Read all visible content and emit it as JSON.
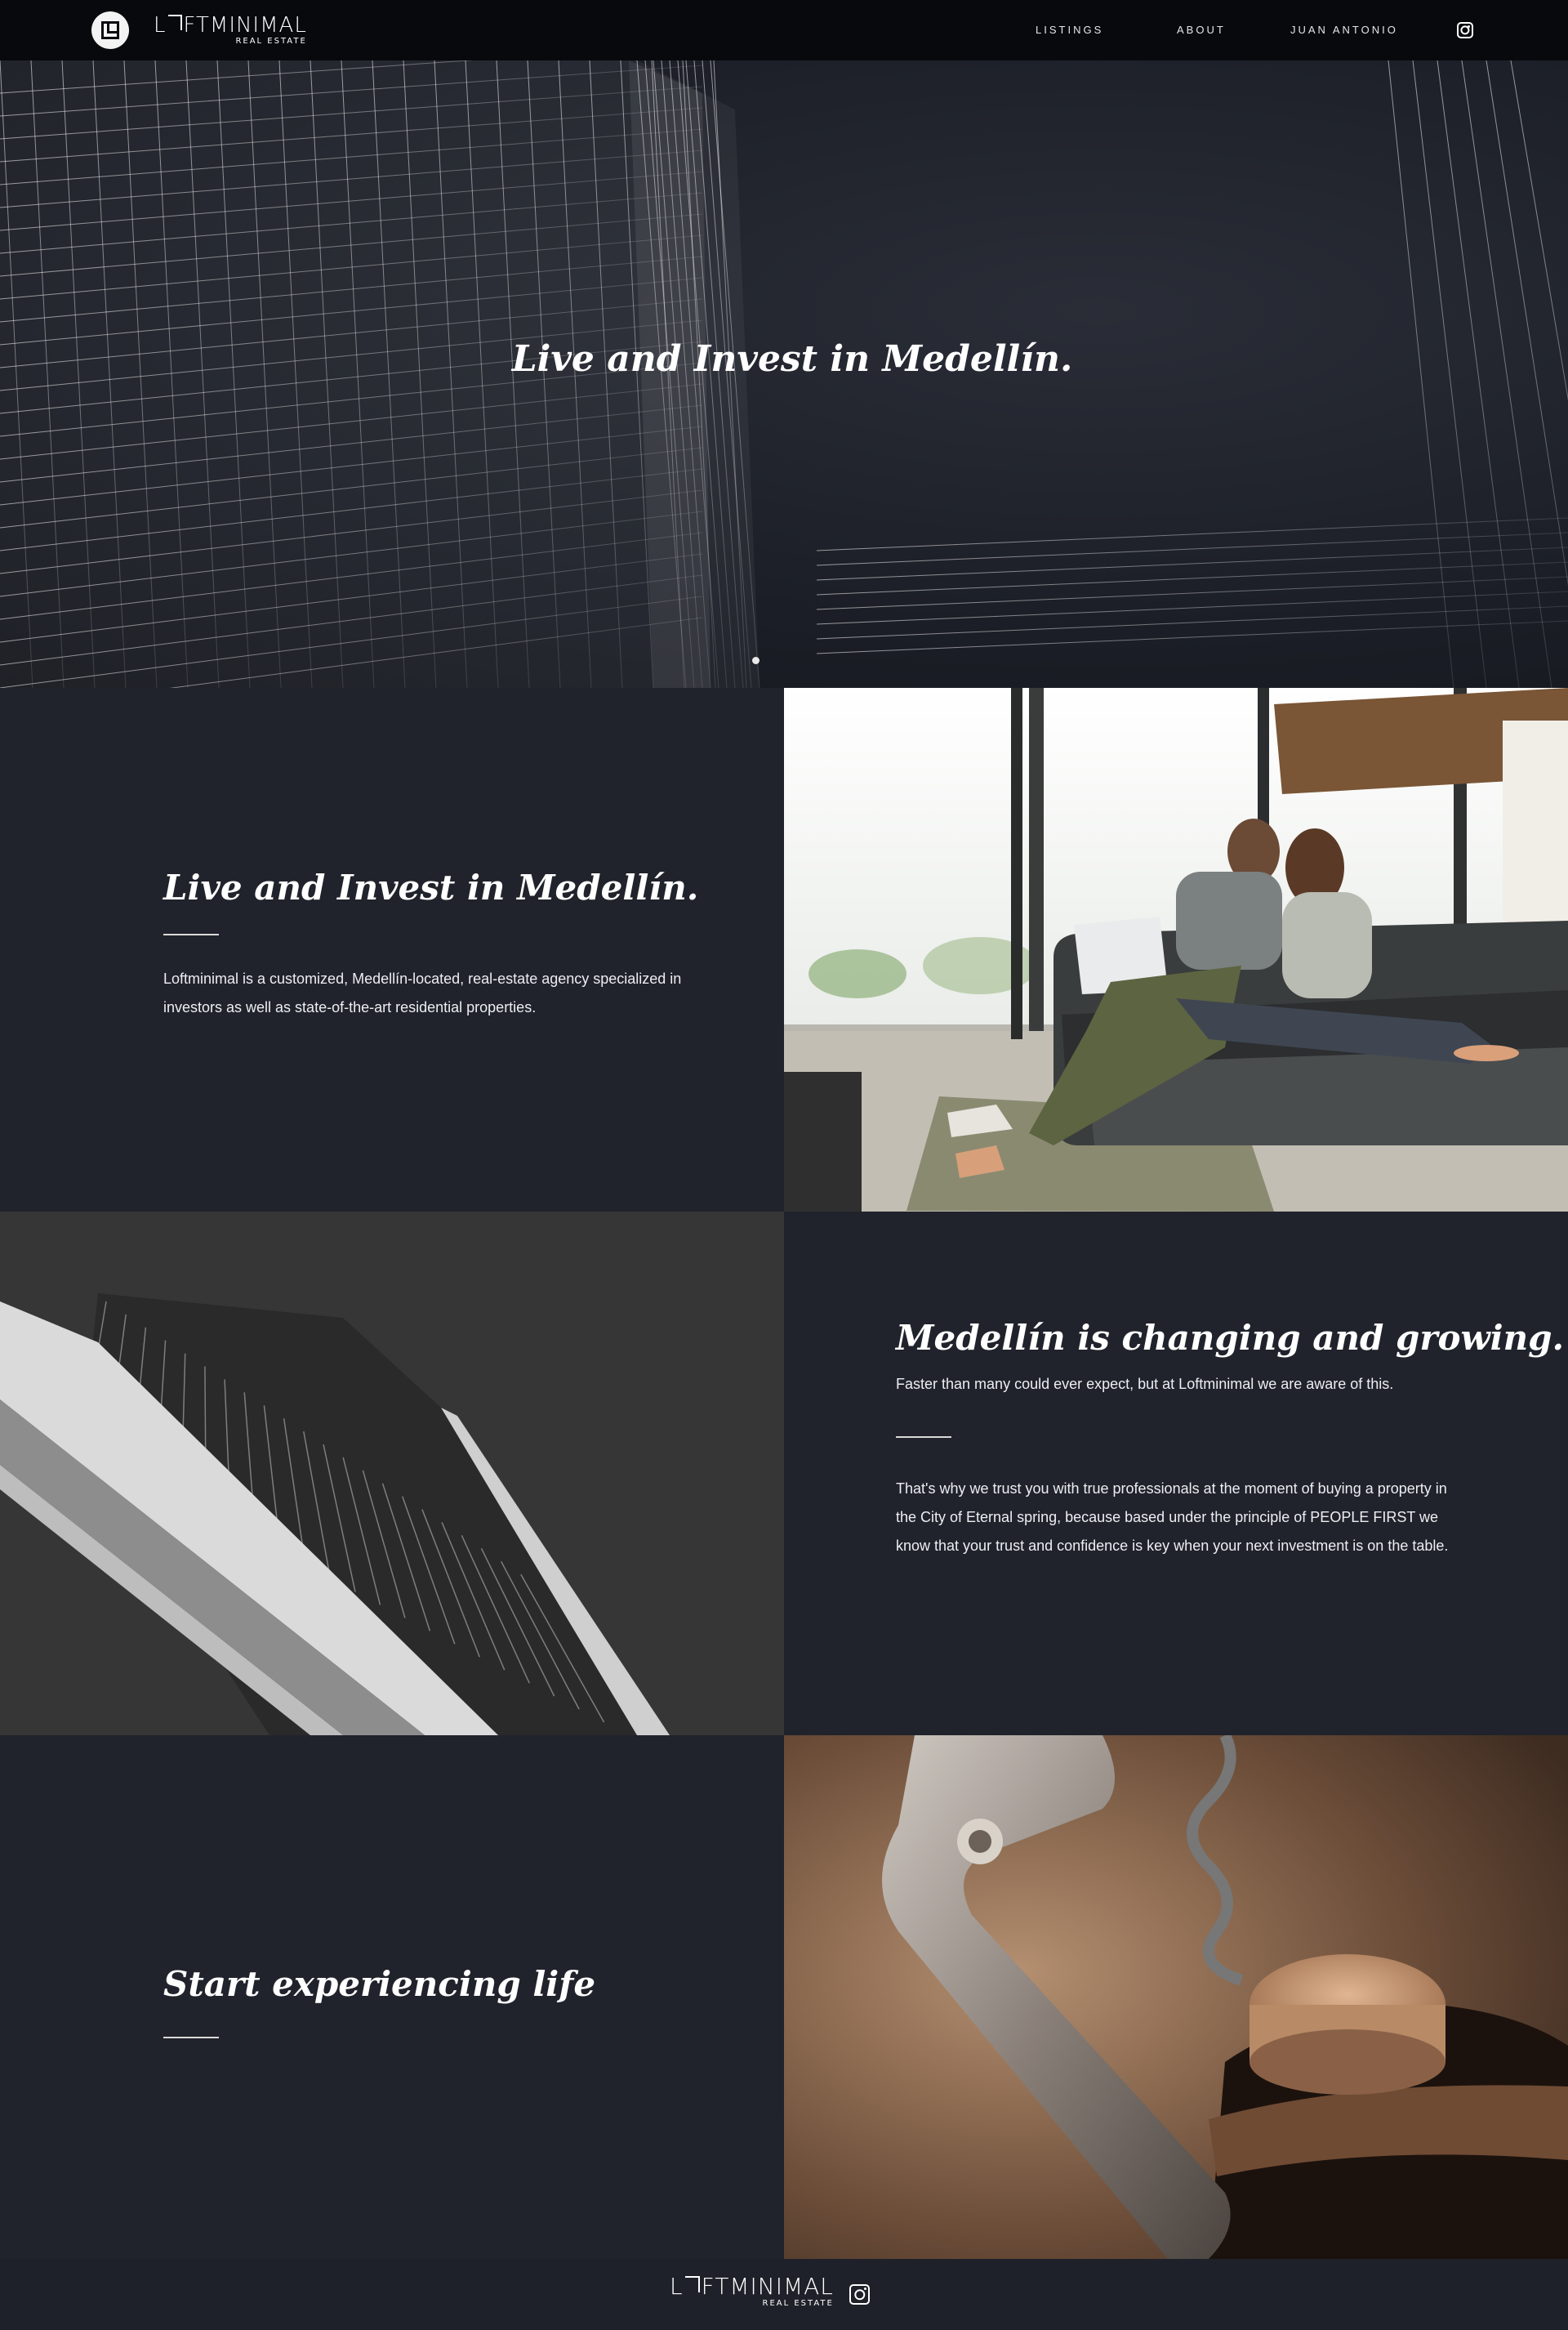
{
  "brand": {
    "name_prefix": "L",
    "name_rest": "FTMINIMAL",
    "tagline": "REAL ESTATE"
  },
  "nav": {
    "items": [
      {
        "label": "LISTINGS"
      },
      {
        "label": "ABOUT"
      },
      {
        "label": "JUAN ANTONIO"
      }
    ],
    "instagram_icon": "instagram-icon"
  },
  "hero": {
    "title": "Live and Invest in Medellín."
  },
  "section1": {
    "title": "Live and Invest in Medellín.",
    "body": "Loftminimal is a customized, Medellín-located, real-estate agency specialized in investors as well as state-of-the-art residential properties."
  },
  "section2": {
    "title": "Medellín is changing and growing. Fast.",
    "subtitle": "Faster than many could ever expect, but at Loftminimal we are aware of this.",
    "body": "That's why we trust you with true professionals at the moment of buying a property in the City of Eternal spring, because based under the principle of PEOPLE FIRST we know that your trust and confidence is key when your next investment is on the table."
  },
  "section3": {
    "title": "Start experiencing life"
  },
  "colors": {
    "nav_bg": "#07090d",
    "panel_bg": "#20232b",
    "footer_bg": "#1e2129",
    "text": "#ffffff"
  }
}
